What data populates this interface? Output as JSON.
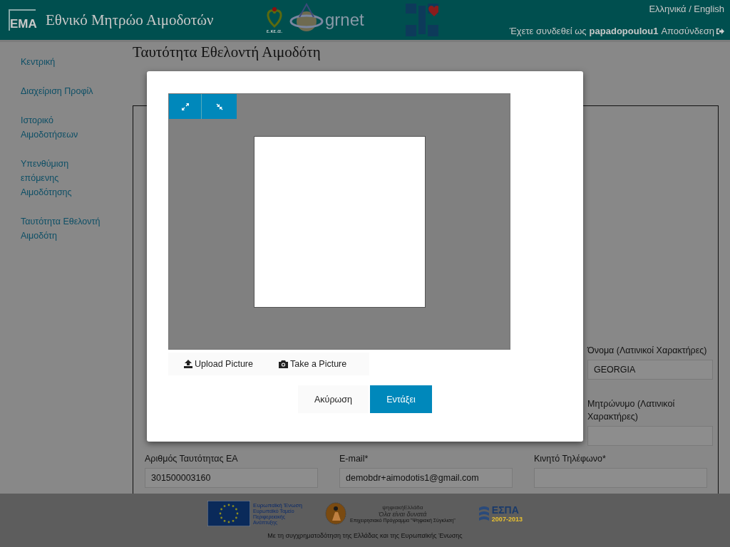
{
  "header": {
    "logo": "ΕΜΑ",
    "title": "Εθνικό Μητρώο Αιμοδοτών",
    "partner_logos": [
      {
        "kind": "ekea",
        "text": "ε.κε.α."
      },
      {
        "kind": "grnet",
        "text": "grnet"
      },
      {
        "kind": "cross"
      }
    ],
    "language": "Ελληνικά / English",
    "login_prefix": "Έχετε συνδεθεί ως",
    "username": "papadopoulou1",
    "logout": "Αποσύνδεση"
  },
  "sidebar": {
    "items": [
      "Κεντρική",
      "Διαχείριση Προφίλ",
      "Ιστορικό Αιμοδοτήσεων",
      "Υπενθύμιση επόμενης Αιμοδότησης",
      "Ταυτότητα Εθελοντή Αιμοδότη"
    ]
  },
  "page": {
    "title": "Ταυτότητα Εθελοντή Αιμοδότη",
    "rows": [
      [
        {
          "label": "Όνομα (Λατινικοί Χαρακτήρες)",
          "value": "GEORGIA"
        }
      ],
      [
        {
          "label": "Μητρώνυμο (Λατινικοί Χαρακτήρες)"
        }
      ],
      [
        {
          "label": "Αριθμός Ταυτότητας ΕΑ",
          "value": "301500003160"
        },
        {
          "label": "E-mail*",
          "value": "demobdr+aimodotis1@gmail.com"
        },
        {
          "label": "Κινητό Τηλέφωνο*"
        }
      ]
    ]
  },
  "modal": {
    "zoom_buttons": [
      {
        "kind": "zoom_in"
      },
      {
        "kind": "zoom_out"
      }
    ],
    "source_buttons": [
      {
        "kind": "upload",
        "label": "Upload Picture"
      },
      {
        "kind": "camera",
        "label": "Take a Picture"
      }
    ],
    "buttons": [
      {
        "kind": "cancel",
        "label": "Ακύρωση"
      },
      {
        "kind": "primary",
        "label": "Εντάξει"
      }
    ]
  },
  "footer": {
    "logos": [
      {
        "kind": "eu",
        "lines": [
          "Ευρωπαϊκή Ένωση",
          "Ευρωπαϊκό Ταμείο Περιφερειακής Ανάπτυξης"
        ]
      },
      {
        "kind": "digital",
        "lines": [
          "ψηφιακήΕλλάδα",
          "Όλα είναι δυνατά",
          "Επιχειρησιακό Πρόγραμμα \"Ψηφιακή Σύγκλιση\""
        ]
      },
      {
        "kind": "espa",
        "lines": [
          "ΕΣΠΑ",
          "2007-2013"
        ]
      }
    ],
    "text": "Με τη συγχρηματοδότηση της Ελλάδας και της Ευρωπαϊκής Ένωσης"
  }
}
